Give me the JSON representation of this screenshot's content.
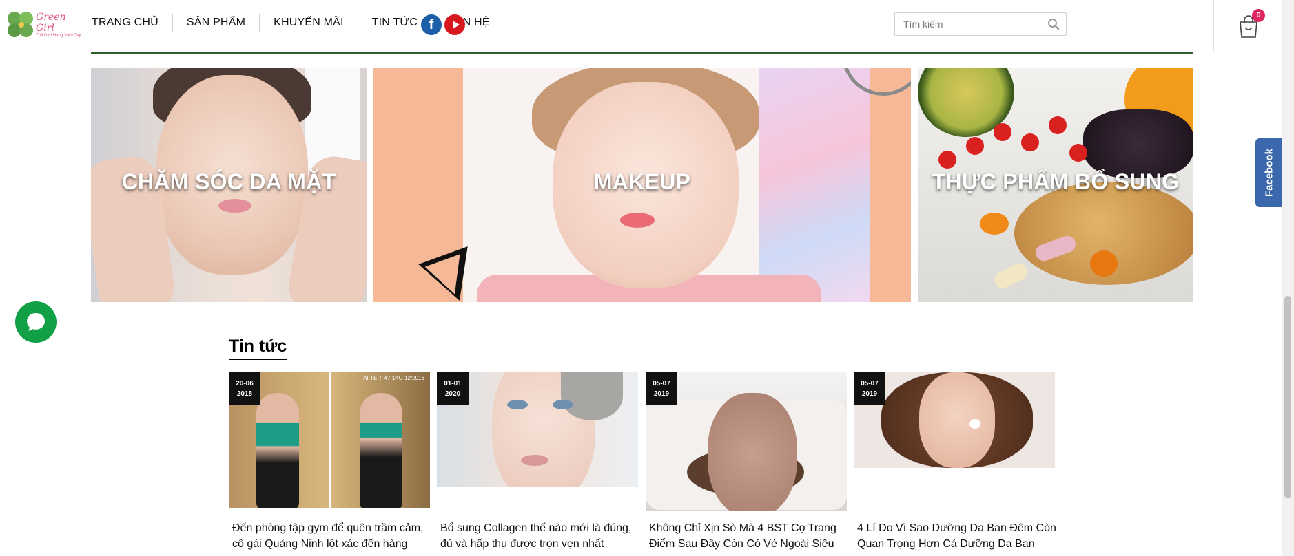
{
  "header": {
    "logo": {
      "name": "Green Girl",
      "tagline": "Thế Giới Hàng Xách Tay"
    },
    "nav": [
      "TRANG CHỦ",
      "SẢN PHẨM",
      "KHUYẾN MÃI",
      "TIN TỨC",
      "LIÊN HỆ"
    ],
    "social": [
      {
        "name": "facebook",
        "icon": "facebook-icon",
        "color": "#1c5ea8"
      },
      {
        "name": "youtube",
        "icon": "youtube-icon",
        "color": "#d7191f"
      }
    ],
    "search": {
      "placeholder": "Tìm kiếm",
      "value": "",
      "icon": "search-icon"
    },
    "cart": {
      "icon": "shopping-bag-icon",
      "count": "0",
      "badge_color": "#e0245e"
    }
  },
  "categories": [
    {
      "label": "CHĂM SÓC DA MẶT"
    },
    {
      "label": "MAKEUP"
    },
    {
      "label": "THỰC PHẨM BỔ SUNG"
    }
  ],
  "news": {
    "heading": "Tin tức",
    "items": [
      {
        "date_day": "20-06",
        "date_year": "2018",
        "title": "Đến phòng tập gym để quên trầm cảm, cô gái Quảng Ninh lột xác đến hàng",
        "thumb_text": "AFTER: 47.1KG 12/2016"
      },
      {
        "date_day": "01-01",
        "date_year": "2020",
        "title": "Bổ sung Collagen thế nào mới là đúng, đủ và hấp thụ được trọn vẹn nhất"
      },
      {
        "date_day": "05-07",
        "date_year": "2019",
        "title": "Không Chỉ Xịn Sò Mà 4 BST Cọ Trang Điểm Sau Đây Còn Có Vẻ Ngoài Siêu"
      },
      {
        "date_day": "05-07",
        "date_year": "2019",
        "title": "4 Lí Do Vì Sao Dưỡng Da Ban Đêm Còn Quan Trọng Hơn Cả Dưỡng Da Ban"
      }
    ]
  },
  "side": {
    "facebook_tab": "Facebook",
    "chat_icon": "chat-bubble-icon",
    "chat_color": "#11a046",
    "facebook_tab_color": "#3b67ad"
  }
}
